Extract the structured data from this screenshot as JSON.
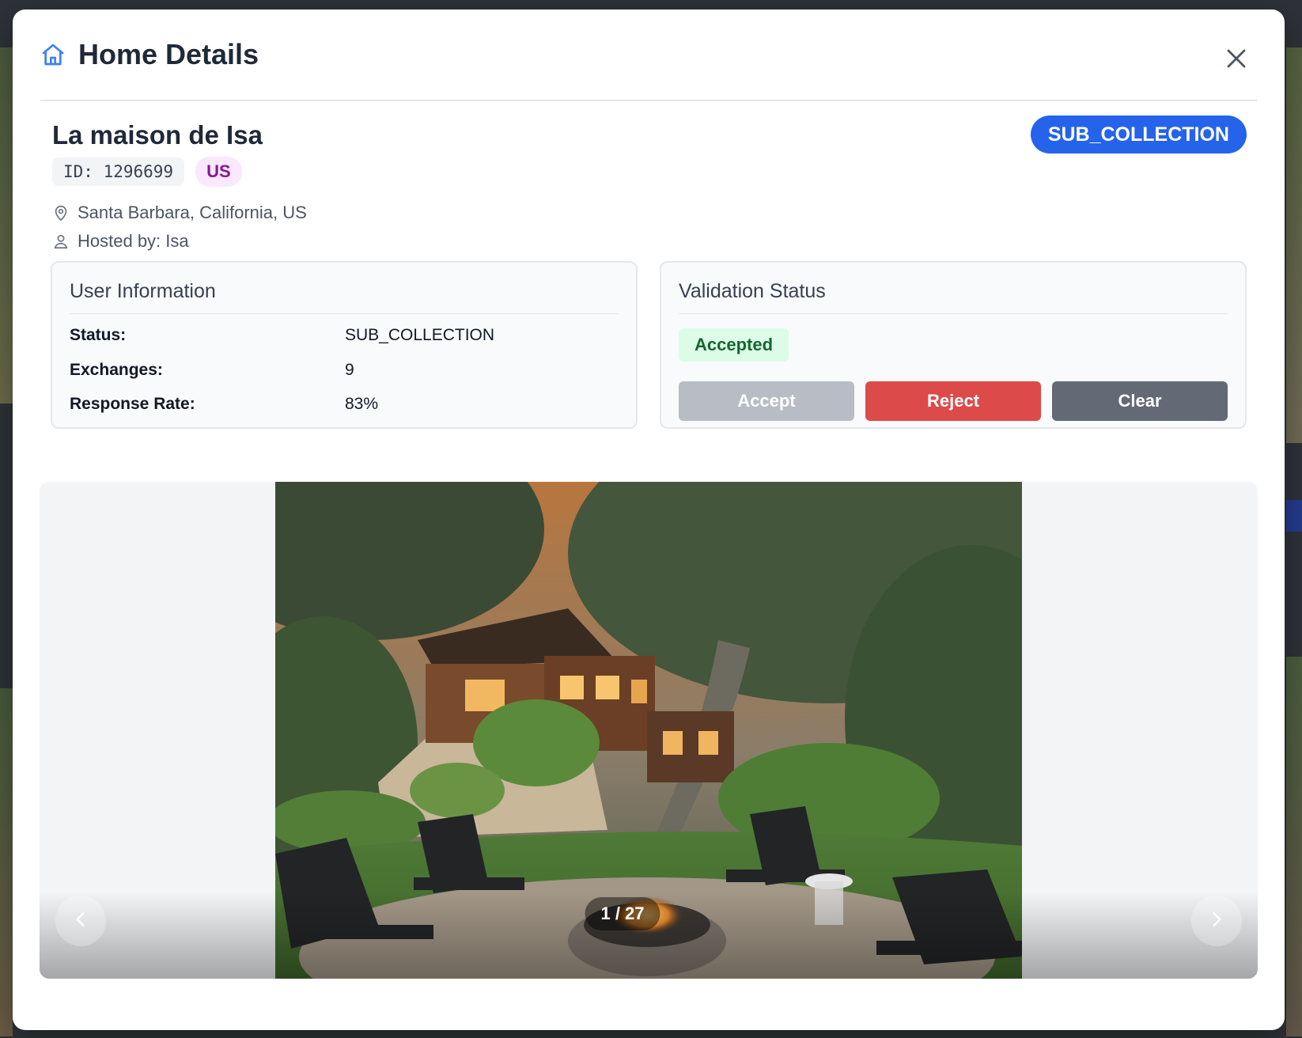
{
  "modal": {
    "title": "Home Details",
    "icons": {
      "header": "home-icon",
      "close": "close-icon"
    }
  },
  "listing": {
    "name": "La maison de Isa",
    "id_label": "ID: 1296699",
    "country": "US",
    "location": "Santa Barbara, California, US",
    "host": "Hosted by: Isa",
    "collection_status": "SUB_COLLECTION",
    "icons": {
      "location": "map-pin-icon",
      "host": "user-icon"
    }
  },
  "user_info": {
    "title": "User Information",
    "rows": [
      {
        "label": "Status:",
        "value": "SUB_COLLECTION"
      },
      {
        "label": "Exchanges:",
        "value": "9"
      },
      {
        "label": "Response Rate:",
        "value": "83%"
      }
    ]
  },
  "validation": {
    "title": "Validation Status",
    "status": "Accepted",
    "buttons": {
      "accept": "Accept",
      "reject": "Reject",
      "clear": "Clear"
    }
  },
  "gallery": {
    "counter": "1 / 27",
    "current": 1,
    "total": 27,
    "icons": {
      "prev": "chevron-left-icon",
      "next": "chevron-right-icon"
    }
  },
  "colors": {
    "accent": "#2563eb",
    "accepted_bg": "#dcfce7",
    "accepted_text": "#166534",
    "reject": "#dc4a4a",
    "clear": "#636975",
    "accept_disabled": "#b8bcc4"
  }
}
